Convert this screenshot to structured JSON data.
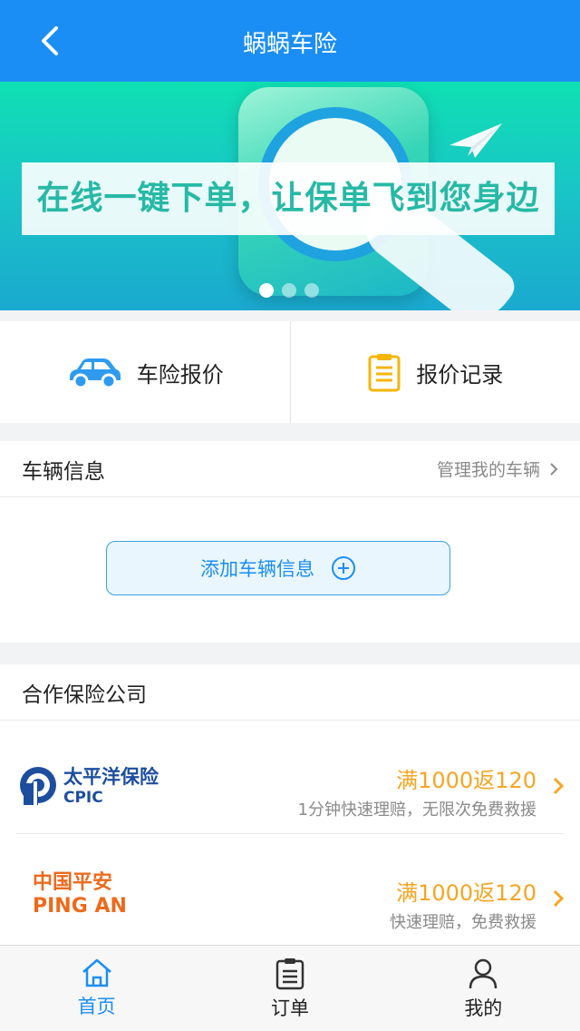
{
  "header": {
    "title": "蜗蜗车险",
    "back_icon": "chevron-left-icon"
  },
  "banner": {
    "slogan": "在线一键下单，让保单飞到您身边",
    "slides_total": 3,
    "active_slide": 1
  },
  "quick_actions": [
    {
      "label": "车险报价",
      "icon": "car-icon"
    },
    {
      "label": "报价记录",
      "icon": "clipboard-icon"
    }
  ],
  "vehicle": {
    "title": "车辆信息",
    "manage_link": "管理我的车辆",
    "add_button": "添加车辆信息"
  },
  "partners": {
    "title": "合作保险公司",
    "items": [
      {
        "name_cn": "太平洋保险",
        "name_en": "CPIC",
        "promo": "满1000返120",
        "desc": "1分钟快速理赔，无限次免费救援"
      },
      {
        "name_cn": "中国平安",
        "name_en": "PING AN",
        "promo": "满1000返120",
        "desc": "快速理赔，免费救援"
      }
    ]
  },
  "tabs": [
    {
      "label": "首页",
      "icon": "home-icon",
      "active": true
    },
    {
      "label": "订单",
      "icon": "order-icon",
      "active": false
    },
    {
      "label": "我的",
      "icon": "user-icon",
      "active": false
    }
  ],
  "colors": {
    "primary": "#1b8ef5",
    "promo": "#f5a623",
    "cpic_blue": "#1d4e9e",
    "pingan_orange": "#ec6a1c"
  }
}
